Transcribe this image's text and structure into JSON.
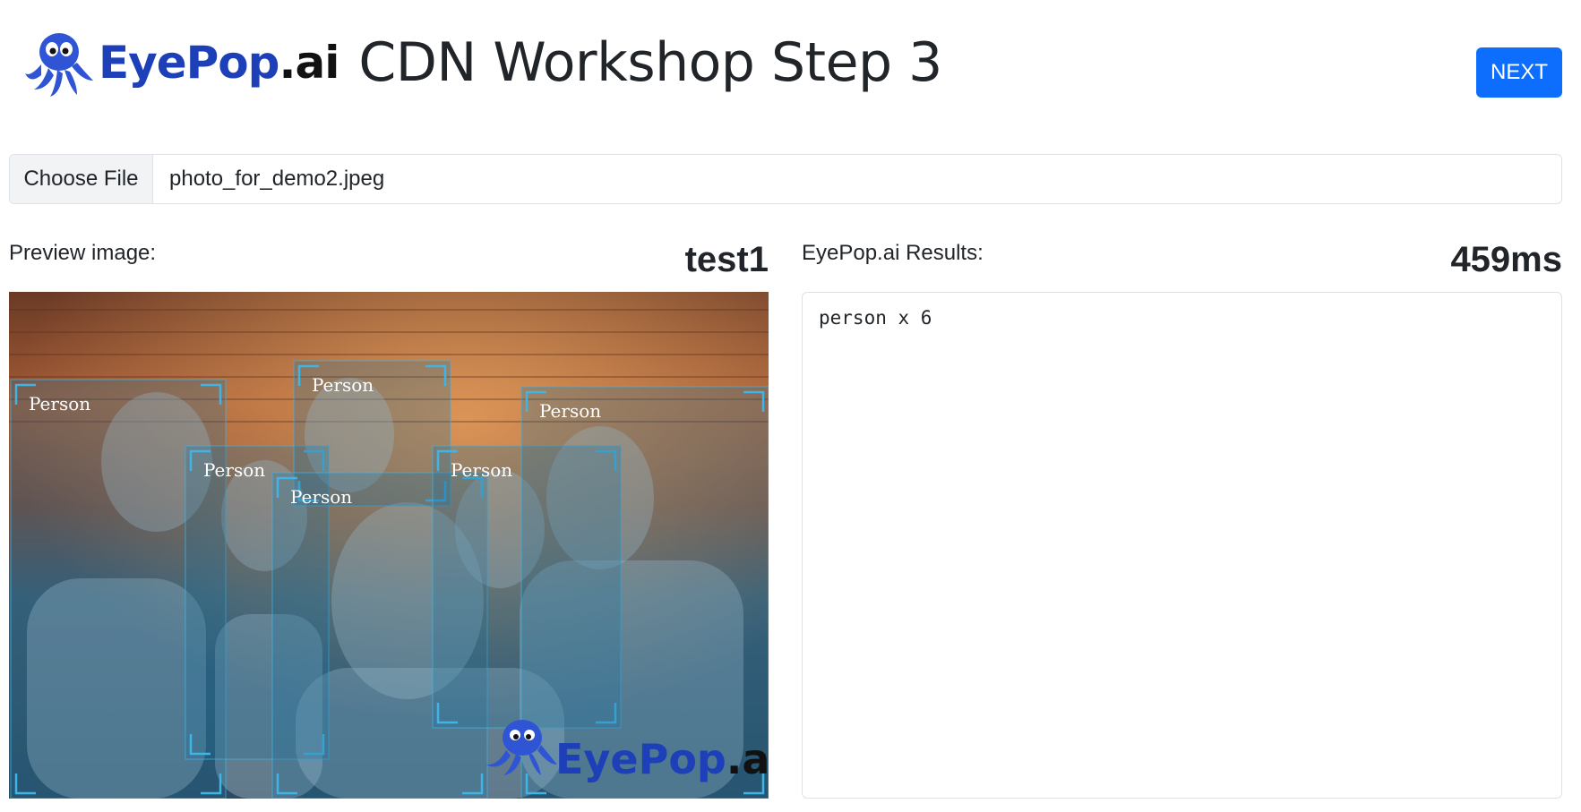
{
  "header": {
    "logo_text_main": "EyePop",
    "logo_text_suffix": ".ai",
    "title": "CDN Workshop Step 3",
    "next_label": "NEXT"
  },
  "file_input": {
    "button_label": "Choose File",
    "file_name": "photo_for_demo2.jpeg"
  },
  "preview": {
    "label": "Preview image:",
    "name": "test1",
    "detections": [
      {
        "label": "Person"
      },
      {
        "label": "Person"
      },
      {
        "label": "Person"
      },
      {
        "label": "Person"
      },
      {
        "label": "Person"
      },
      {
        "label": "Person"
      }
    ],
    "watermark_main": "EyePop",
    "watermark_suffix": ".ai"
  },
  "results": {
    "label": "EyePop.ai Results:",
    "time": "459ms",
    "text": "person x 6"
  },
  "colors": {
    "accent": "#0d6efd",
    "logo_blue": "#1d3fb8",
    "box_cyan": "#3fb4e6"
  }
}
